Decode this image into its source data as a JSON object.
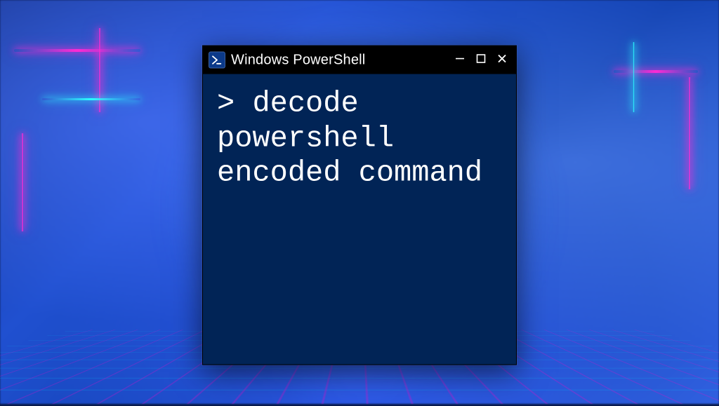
{
  "window": {
    "title": "Windows PowerShell",
    "icon": "powershell-icon",
    "controls": {
      "minimize": "—",
      "maximize": "▢",
      "close": "✕"
    }
  },
  "terminal": {
    "prompt": ">",
    "command": "decode powershell encoded command"
  },
  "colors": {
    "terminal_bg": "#012456",
    "titlebar_bg": "#000000",
    "text": "#ffffff",
    "neon_pink": "#ff2ad4",
    "neon_cyan": "#2affff"
  }
}
